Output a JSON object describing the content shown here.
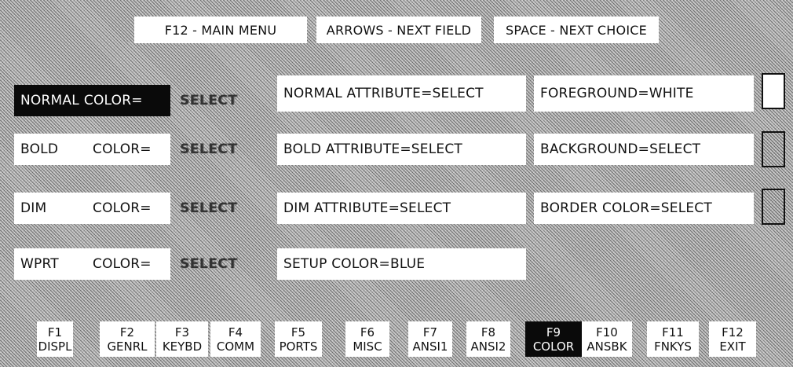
{
  "header": {
    "main_menu": "F12 - MAIN MENU",
    "arrows": "ARROWS - NEXT FIELD",
    "space": "SPACE - NEXT CHOICE"
  },
  "color_rows": [
    {
      "name": "NORMAL",
      "label": "COLOR=",
      "value": "SELECT"
    },
    {
      "name": "BOLD",
      "label": "COLOR=",
      "value": "SELECT"
    },
    {
      "name": "DIM",
      "label": "COLOR=",
      "value": "SELECT"
    },
    {
      "name": "WPRT",
      "label": "COLOR=",
      "value": "SELECT"
    }
  ],
  "attributes": {
    "normal": "NORMAL ATTRIBUTE=SELECT",
    "bold": "BOLD ATTRIBUTE=SELECT",
    "dim": "DIM ATTRIBUTE=SELECT",
    "setup_color": "SETUP COLOR=BLUE"
  },
  "screen_colors": {
    "foreground": "FOREGROUND=WHITE",
    "background": "BACKGROUND=SELECT",
    "border": "BORDER COLOR=SELECT"
  },
  "function_keys": [
    {
      "key": "F1",
      "label": "DISPL"
    },
    {
      "key": "F2",
      "label": "GENRL"
    },
    {
      "key": "F3",
      "label": "KEYBD"
    },
    {
      "key": "F4",
      "label": "COMM"
    },
    {
      "key": "F5",
      "label": "PORTS"
    },
    {
      "key": "F6",
      "label": "MISC"
    },
    {
      "key": "F7",
      "label": "ANSI1"
    },
    {
      "key": "F8",
      "label": "ANSI2"
    },
    {
      "key": "F9",
      "label": "COLOR"
    },
    {
      "key": "F10",
      "label": "ANSBK"
    },
    {
      "key": "F11",
      "label": "FNKYS"
    },
    {
      "key": "F12",
      "label": "EXIT"
    }
  ],
  "active_function_key": "F9",
  "colors": {
    "background": "#bcbcbc",
    "field": "#ffffff",
    "highlight": "#0a0a0a"
  }
}
